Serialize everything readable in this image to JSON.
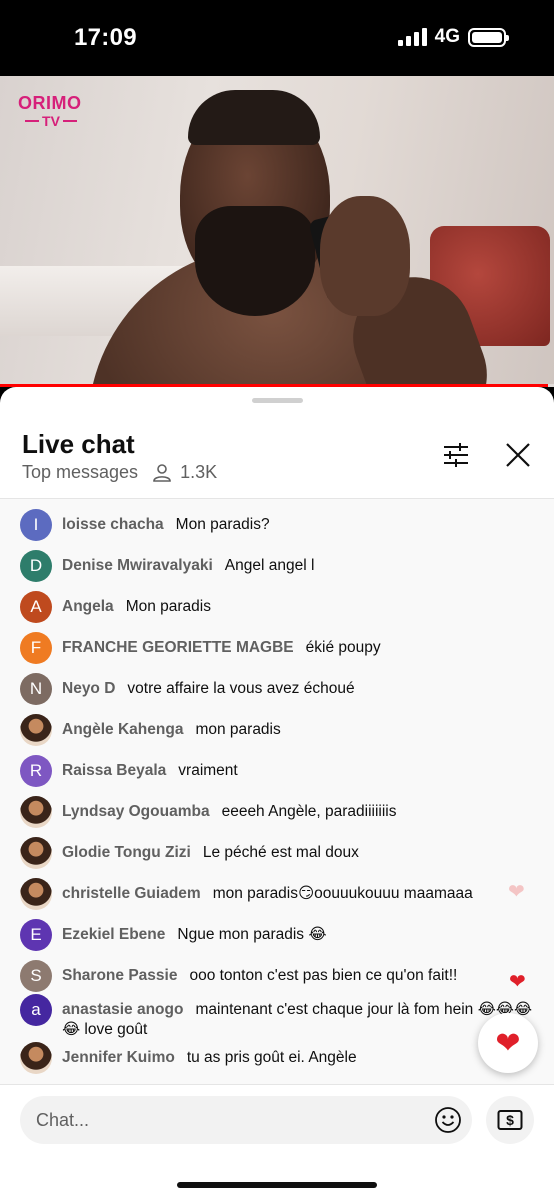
{
  "status_bar": {
    "time": "17:09",
    "network": "4G"
  },
  "video": {
    "logo_line1": "ORIMO",
    "logo_line2": "TV",
    "progress_percent": 99
  },
  "header": {
    "title": "Live chat",
    "mode": "Top messages",
    "viewer_count": "1.3K"
  },
  "colors": {
    "accent_red": "#ff0000",
    "heart": "#e0202a",
    "logo_pink": "#d6207a"
  },
  "messages": [
    {
      "author": "loisse chacha",
      "text": "Mon paradis?",
      "avatar_letter": "I",
      "avatar_color": "#5c6bc0"
    },
    {
      "author": "Denise Mwiravalyaki",
      "text": "Angel angel l",
      "avatar_letter": "D",
      "avatar_color": "#2e7d6b"
    },
    {
      "author": "Angela",
      "text": "Mon paradis",
      "avatar_letter": "A",
      "avatar_color": "#bf4a1e"
    },
    {
      "author": "FRANCHE GEORIETTE MAGBE",
      "text": "ékié poupy",
      "avatar_letter": "F",
      "avatar_color": "#ef7b22"
    },
    {
      "author": "Neyo D",
      "text": "votre affaire la vous avez échoué",
      "avatar_letter": "N",
      "avatar_color": "#7d6b62"
    },
    {
      "author": "Angèle Kahenga",
      "text": "mon paradis",
      "avatar_letter": "",
      "avatar_color": ""
    },
    {
      "author": "Raissa Beyala",
      "text": "vraiment",
      "avatar_letter": "R",
      "avatar_color": "#7e57c2"
    },
    {
      "author": "Lyndsay Ogouamba",
      "text": "eeeeh Angèle, paradiiiiiiis",
      "avatar_letter": "",
      "avatar_color": ""
    },
    {
      "author": "Glodie Tongu Zizi",
      "text": "Le péché est mal doux",
      "avatar_letter": "",
      "avatar_color": ""
    },
    {
      "author": "christelle Guiadem",
      "text": "mon paradis😏oouuukouuu maamaaa",
      "avatar_letter": "",
      "avatar_color": ""
    },
    {
      "author": "Ezekiel Ebene",
      "text": "Ngue mon paradis 😂",
      "avatar_letter": "E",
      "avatar_color": "#5e35b1"
    },
    {
      "author": "Sharone Passie",
      "text": "ooo tonton c'est pas bien ce qu'on fait!!",
      "avatar_letter": "S",
      "avatar_color": "#8d7a70"
    },
    {
      "author": "anastasie anogo",
      "text": "maintenant c'est chaque jour là fom hein 😂😂😂😂 love goût",
      "avatar_letter": "a",
      "avatar_color": "#4527a0"
    },
    {
      "author": "Jennifer Kuimo",
      "text": "tu as pris goût ei. Angèle",
      "avatar_letter": "",
      "avatar_color": ""
    }
  ],
  "input": {
    "placeholder": "Chat..."
  },
  "icons": {
    "filter": "tune-icon",
    "close": "close-icon",
    "viewers": "person-icon",
    "emoji": "smiley-icon",
    "super_chat": "dollar-icon",
    "heart": "heart-icon"
  }
}
